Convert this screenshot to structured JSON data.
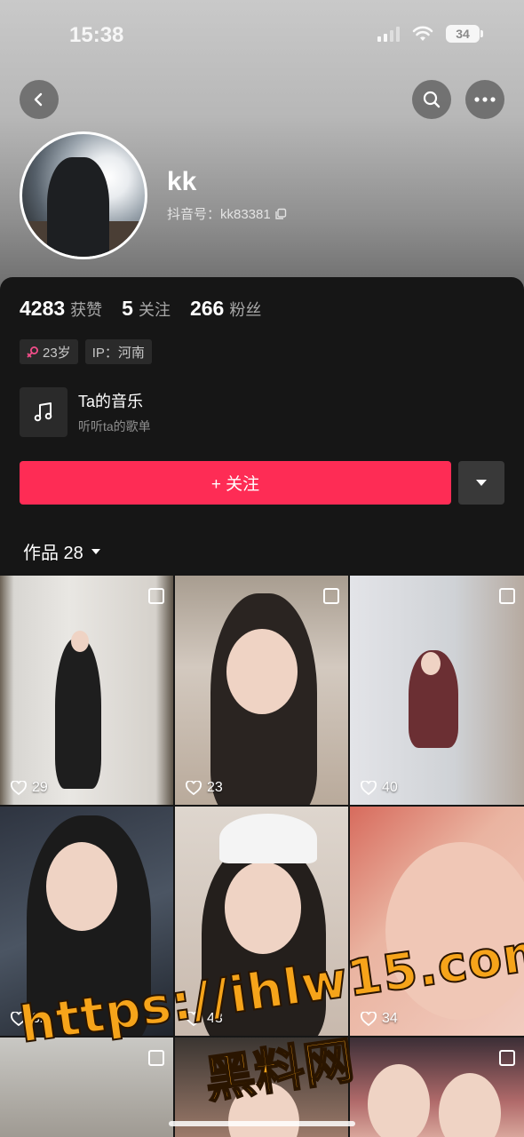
{
  "status_bar": {
    "time": "15:38",
    "battery": "34"
  },
  "profile": {
    "username": "kk",
    "douyin_id": "抖音号：kk83381",
    "stats": [
      {
        "num": "4283",
        "label": "获赞"
      },
      {
        "num": "5",
        "label": "关注"
      },
      {
        "num": "266",
        "label": "粉丝"
      }
    ],
    "tags": {
      "age": "23岁",
      "ip": "IP：河南"
    },
    "music": {
      "title": "Ta的音乐",
      "subtitle": "听听ta的歌单"
    },
    "follow_label": "+ 关注"
  },
  "works": {
    "tab_label": "作品 28",
    "items": [
      {
        "likes": "29"
      },
      {
        "likes": "23"
      },
      {
        "likes": "40"
      },
      {
        "likes": "32"
      },
      {
        "likes": "43"
      },
      {
        "likes": "34"
      },
      {
        "likes": ""
      },
      {
        "likes": ""
      },
      {
        "likes": ""
      }
    ]
  },
  "watermark": {
    "url": "https://ihlw15.com",
    "cn": "黑料网"
  },
  "colors": {
    "follow": "#fe2c55",
    "watermark": "#f6a41a",
    "female": "#f34e8a"
  },
  "icons": [
    "back-icon",
    "search-icon",
    "more-icon",
    "music-note-icon",
    "heart-icon",
    "multi-image-icon",
    "caret-down-icon",
    "copy-icon",
    "female-icon"
  ]
}
